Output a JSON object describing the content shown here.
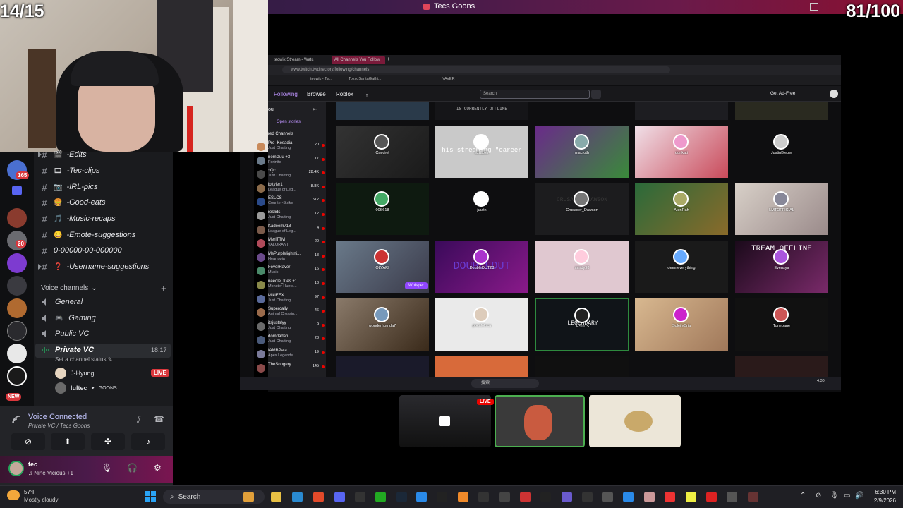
{
  "overlay": {
    "counter_left": "14/15",
    "counter_right": "81/100",
    "window_title": "Tecs Goons"
  },
  "discord": {
    "guild_badges": [
      "165",
      "20"
    ],
    "new_badge": "NEW",
    "text_channels": [
      {
        "label": "-Edits",
        "emoji": "🎬"
      },
      {
        "label": "-Tec-clips",
        "emoji": "🎞"
      },
      {
        "label": "-IRL-pics",
        "emoji": "📷"
      },
      {
        "label": "-Good-eats",
        "emoji": "🍔"
      },
      {
        "label": "-Music-recaps",
        "emoji": "🎵"
      },
      {
        "label": "-Emote-suggestions",
        "emoji": "😀"
      },
      {
        "label": "0-00000-00-000000",
        "emoji": ""
      },
      {
        "label": "-Username-suggestions",
        "emoji": "❓"
      }
    ],
    "voice_header": "Voice channels",
    "voice_channels": [
      {
        "label": "General",
        "emoji": "🔈"
      },
      {
        "label": "Gaming",
        "emoji": "🎮"
      },
      {
        "label": "Public VC",
        "emoji": ""
      },
      {
        "label": "Private VC",
        "emoji": ""
      }
    ],
    "private_vc_time": "18:17",
    "set_status": "Set a channel status",
    "voice_users": [
      {
        "name": "J-Hyung",
        "live": "LIVE"
      },
      {
        "name": "lultec",
        "tag": "GOONS"
      }
    ],
    "voice_connected": "Voice Connected",
    "voice_sub": "Private VC / Tecs Goons",
    "user": {
      "name": "tec",
      "activity": "Nine Vicious +1"
    }
  },
  "browser": {
    "tabs": [
      "tecwik Stream - Watc",
      "All Channels You Follow"
    ],
    "url": "www.twitch.tv/directory/following/channels",
    "bookmarks": [
      "tecwik - Tw...",
      "TokyoSantaGathi...",
      "NAVER"
    ],
    "nav": {
      "following": "Following",
      "browse": "Browse",
      "roblox": "Roblox"
    },
    "search_placeholder": "Search",
    "ad_free": "Get Ad-Free",
    "side_header": "ou",
    "open_stories": "Open stories",
    "side_section": "red Channels",
    "side_channels": [
      {
        "name": "Pro_Kesadia",
        "game": "Just Chatting",
        "viewers": "20"
      },
      {
        "name": "nomizuu +3",
        "game": "Fortnite",
        "viewers": "17"
      },
      {
        "name": "xQc",
        "game": "Just Chatting",
        "viewers": "28.4K"
      },
      {
        "name": "loltyler1",
        "game": "League of Leg...",
        "viewers": "8.8K"
      },
      {
        "name": "ESLCS",
        "game": "Counter-Strike",
        "viewers": "512"
      },
      {
        "name": "reslids",
        "game": "Just Chatting",
        "viewers": "12"
      },
      {
        "name": "Kadeem718",
        "game": "League of Leg...",
        "viewers": "4"
      },
      {
        "name": "MeriTTM",
        "game": "VALORANT",
        "viewers": "20"
      },
      {
        "name": "MsPurplelightni...",
        "game": "Heartopia",
        "viewers": "18"
      },
      {
        "name": "FeverRaver",
        "game": "Music",
        "viewers": "16"
      },
      {
        "name": "needle_t0es +1",
        "game": "Monster Hunte...",
        "viewers": "18"
      },
      {
        "name": "MikiEEX",
        "game": "Just Chatting",
        "viewers": "97"
      },
      {
        "name": "Supercally",
        "game": "Animal Crossin...",
        "viewers": "46"
      },
      {
        "name": "itsjustslyy",
        "game": "Just Chatting",
        "viewers": "9"
      },
      {
        "name": "domdadah",
        "game": "Just Chatting",
        "viewers": "28"
      },
      {
        "name": "IAMBPala",
        "game": "Apex Legends",
        "viewers": "19"
      },
      {
        "name": "TheSongery",
        "game": "",
        "viewers": "145"
      }
    ],
    "top_row_text": "IS CURRENTLY OFFLINE",
    "cards": [
      {
        "name": "Caedrel"
      },
      {
        "name": "ezrabler",
        "overlay": "his streaming \"career"
      },
      {
        "name": "macroth"
      },
      {
        "name": "durikati"
      },
      {
        "name": "JustinBieber"
      },
      {
        "name": "00S618"
      },
      {
        "name": "juufin"
      },
      {
        "name": "Crusader_Dawson",
        "overlay": "CRUSADER DAWSON"
      },
      {
        "name": "AtenRah"
      },
      {
        "name": "LMTOFFICIAL"
      },
      {
        "name": "OLVARI"
      },
      {
        "name": "DoubleDUT23",
        "overlay": "DOUBLEDUT"
      },
      {
        "name": "mindy98"
      },
      {
        "name": "deemeverything"
      },
      {
        "name": "Evensya",
        "overlay": "TREAM OFFLINE"
      },
      {
        "name": "wonderfromda7"
      },
      {
        "name": "pocaloloca"
      },
      {
        "name": "ESLCS",
        "overlay": "LEGENDARY"
      },
      {
        "name": "SoleilyBria"
      },
      {
        "name": "Tonebane"
      }
    ],
    "whisper": "Whisper",
    "inner_search": "搜索",
    "inner_clock": "4:30"
  },
  "thumbnails": {
    "live": "LIVE"
  },
  "taskbar": {
    "temp": "57°F",
    "weather": "Mostly cloudy",
    "search": "Search",
    "time": "6:30 PM",
    "date": "2/9/2026"
  }
}
